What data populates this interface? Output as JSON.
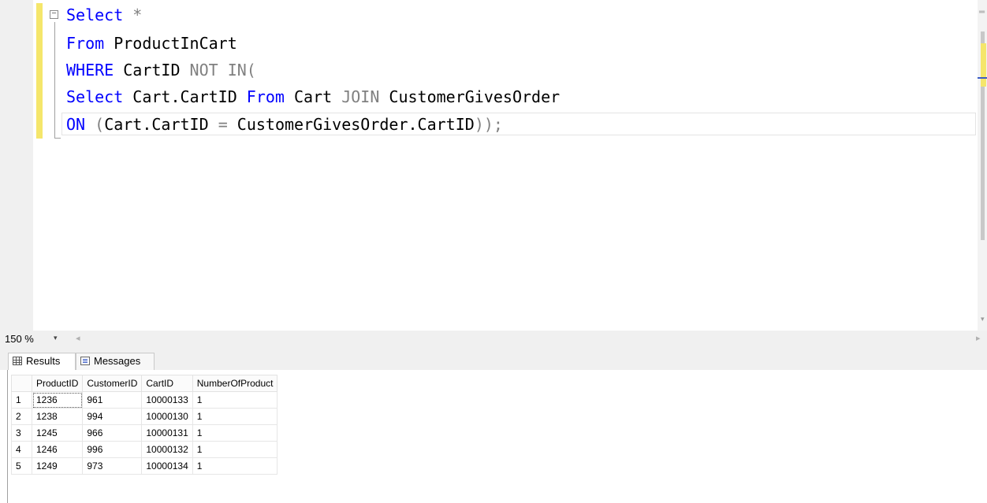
{
  "editor": {
    "collapse_glyph": "−",
    "lines": {
      "l1": {
        "kw": "Select",
        "rest": " *"
      },
      "l2": {
        "kw": "From",
        "rest": " ProductInCart"
      },
      "l3": {
        "kw": "WHERE",
        "mid": " CartID ",
        "gray": "NOT IN("
      },
      "l4": {
        "kw1": "Select",
        "mid1": " Cart.CartID ",
        "kw2": "From",
        "mid2": " Cart ",
        "gray": "JOIN",
        "rest": " CustomerGivesOrder"
      },
      "l5": {
        "kw": "ON",
        "gray1": " (",
        "mid": "Cart.CartID ",
        "gray2": "=",
        "mid2": " CustomerGivesOrder.CartID",
        "gray3": "));"
      }
    }
  },
  "zoom": {
    "value": "150 %",
    "dropdown_glyph": "▾",
    "left_arrow": "◂",
    "right_arrow": "▸"
  },
  "tabs": {
    "results": "Results",
    "messages": "Messages"
  },
  "results": {
    "columns": [
      "ProductID",
      "CustomerID",
      "CartID",
      "NumberOfProduct"
    ],
    "rows": [
      {
        "n": "1",
        "cells": [
          "1236",
          "961",
          "10000133",
          "1"
        ]
      },
      {
        "n": "2",
        "cells": [
          "1238",
          "994",
          "10000130",
          "1"
        ]
      },
      {
        "n": "3",
        "cells": [
          "1245",
          "966",
          "10000131",
          "1"
        ]
      },
      {
        "n": "4",
        "cells": [
          "1246",
          "996",
          "10000132",
          "1"
        ]
      },
      {
        "n": "5",
        "cells": [
          "1249",
          "973",
          "10000134",
          "1"
        ]
      }
    ]
  },
  "colors": {
    "keyword": "#0000ff",
    "operator": "#808080",
    "change_bar": "#f5e66b"
  }
}
